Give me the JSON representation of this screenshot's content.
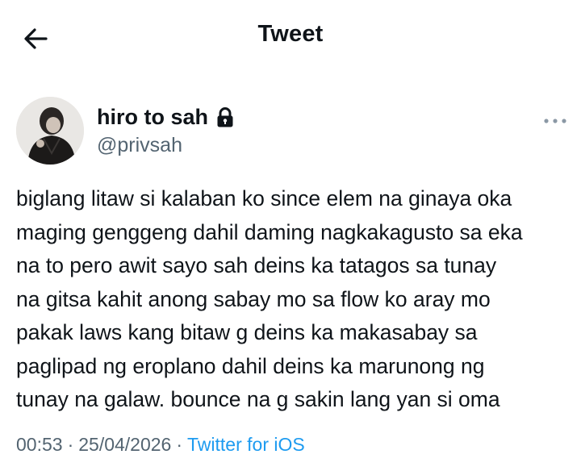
{
  "header": {
    "title": "Tweet",
    "back_icon": "arrow-left-icon"
  },
  "author": {
    "display_name": "hiro to sah",
    "handle": "@privsah",
    "protected_icon": "lock-icon",
    "avatar_icon": "avatar"
  },
  "tweet": {
    "lines": [
      "biglang litaw si kalaban ko since elem na ginaya oka",
      "maging genggeng dahil daming nagkakagusto sa eka",
      "na to pero awit sayo sah deins ka tatagos sa tunay",
      "na gitsa kahit anong sabay mo sa flow ko aray mo",
      "pakak laws kang bitaw g deins ka makasabay sa",
      "paglipad ng eroplano dahil deins ka marunong ng",
      "tunay na galaw. bounce na g sakin lang yan si oma"
    ]
  },
  "meta": {
    "time": "00:53",
    "separator": "·",
    "date": "25/04/2026",
    "source": "Twitter for iOS"
  },
  "colors": {
    "text": "#0f1419",
    "secondary": "#536471",
    "accent": "#1d9bf0"
  }
}
